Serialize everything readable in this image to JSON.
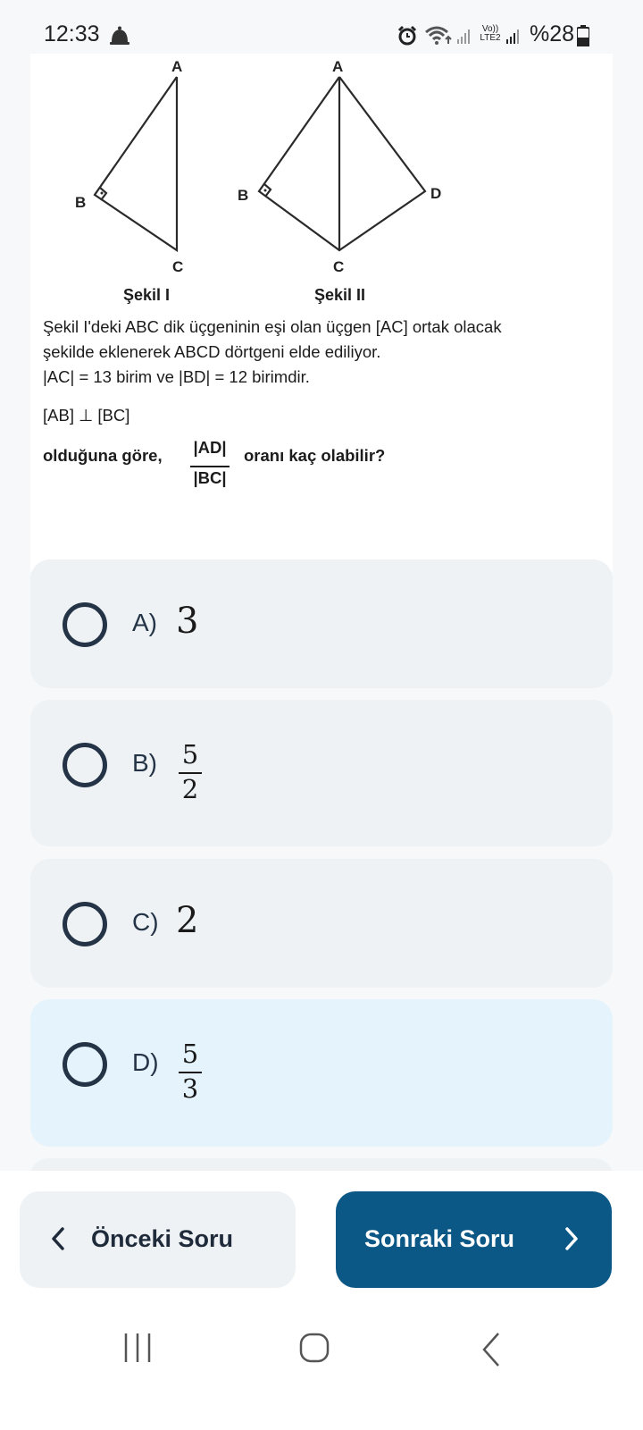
{
  "status_bar": {
    "time": "12:33",
    "battery": "%28",
    "network_label": "Vo)) LTE2",
    "icons": [
      "notification-bell-icon",
      "alarm-icon",
      "wifi-icon",
      "signal-icon",
      "battery-icon"
    ]
  },
  "question": {
    "figure": {
      "labels": {
        "fig1_A": "A",
        "fig1_B": "B",
        "fig1_C": "C",
        "fig2_A": "A",
        "fig2_B": "B",
        "fig2_C": "C",
        "fig2_D": "D"
      },
      "caption_1": "Şekil I",
      "caption_2": "Şekil II"
    },
    "line1": "Şekil I'deki ABC dik üçgeninin eşi olan üçgen [AC] ortak olacak",
    "line2": "şekilde eklenerek ABCD dörtgeni elde ediliyor.",
    "line3": "|AC| = 13 birim ve |BD| = 12 birimdir.",
    "line4": "[AB] ⊥ [BC]",
    "prompt_prefix": "olduğuna göre,",
    "fraction_numerator": "|AD|",
    "fraction_denominator": "|BC|",
    "prompt_suffix": "oranı kaç olabilir?"
  },
  "options": [
    {
      "letter": "A)",
      "value": "3"
    },
    {
      "letter": "B)",
      "numerator": "5",
      "denominator": "2"
    },
    {
      "letter": "C)",
      "value": "2"
    },
    {
      "letter": "D)",
      "numerator": "5",
      "denominator": "3"
    }
  ],
  "navigation": {
    "prev_label": "Önceki Soru",
    "next_label": "Sonraki Soru"
  },
  "colors": {
    "primary": "#0b5785",
    "option_bg": "#eef2f5",
    "option_selected_bg": "#e5f4fc",
    "radio": "#243446"
  }
}
